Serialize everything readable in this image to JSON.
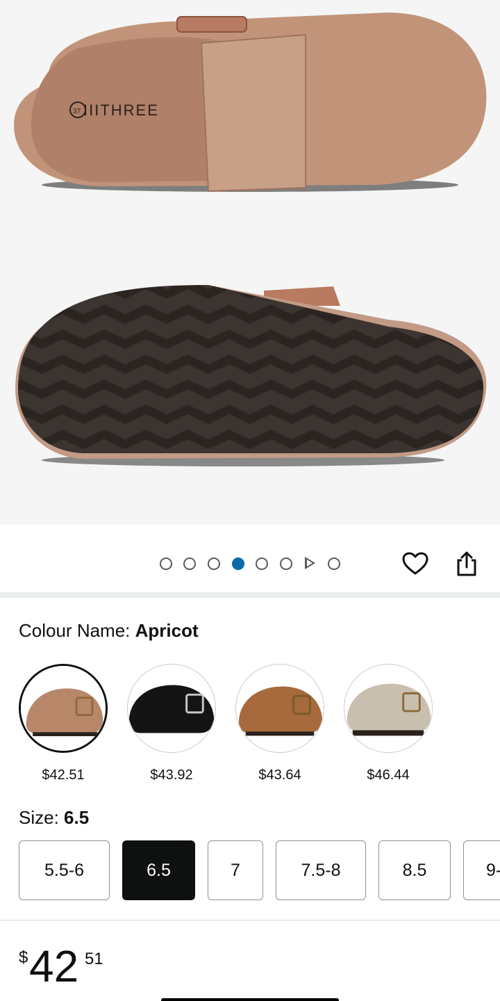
{
  "product": {
    "image_brand_mark": "IIITHREE",
    "image_size_mark": "37"
  },
  "gallery": {
    "total_images": 8,
    "active_index": 4,
    "video_index": 7
  },
  "actions": {
    "favorite_icon": "heart-outline-icon",
    "share_icon": "share-icon"
  },
  "colour": {
    "label": "Colour Name: ",
    "selected": "Apricot",
    "options": [
      {
        "color": "#b8876a",
        "price": "$42.51"
      },
      {
        "color": "#141414",
        "price": "$43.92"
      },
      {
        "color": "#a66a3c",
        "price": "$43.64"
      },
      {
        "color": "#c9bfae",
        "price": "$46.44"
      }
    ]
  },
  "size": {
    "label": "Size: ",
    "selected": "6.5",
    "options": [
      "5.5-6",
      "6.5",
      "7",
      "7.5-8",
      "8.5",
      "9-"
    ]
  },
  "price": {
    "currency": "$",
    "whole": "42",
    "fraction": "51"
  },
  "colors": {
    "accent": "#0a6ba8",
    "selected_bg": "#0f1111"
  }
}
